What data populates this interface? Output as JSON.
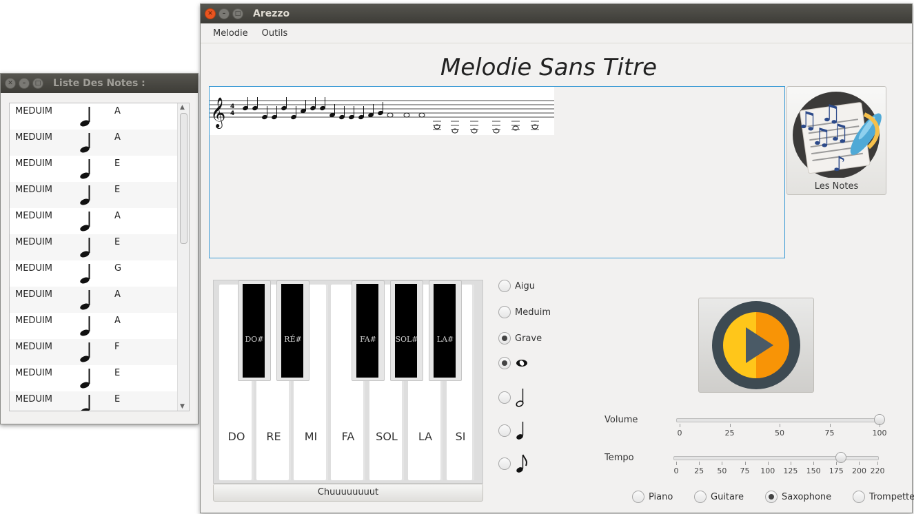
{
  "notes_window": {
    "title": "Liste Des Notes :",
    "rows": [
      {
        "level": "MEDUIM",
        "note": "A"
      },
      {
        "level": "MEDUIM",
        "note": "A"
      },
      {
        "level": "MEDUIM",
        "note": "E"
      },
      {
        "level": "MEDUIM",
        "note": "E"
      },
      {
        "level": "MEDUIM",
        "note": "A"
      },
      {
        "level": "MEDUIM",
        "note": "E"
      },
      {
        "level": "MEDUIM",
        "note": "G"
      },
      {
        "level": "MEDUIM",
        "note": "A"
      },
      {
        "level": "MEDUIM",
        "note": "A"
      },
      {
        "level": "MEDUIM",
        "note": "F"
      },
      {
        "level": "MEDUIM",
        "note": "E"
      },
      {
        "level": "MEDUIM",
        "note": "E"
      }
    ]
  },
  "main_window": {
    "title": "Arezzo",
    "menus": [
      "Melodie",
      "Outils"
    ],
    "melody_title": "Melodie Sans Titre",
    "notes_button_label": "Les Notes",
    "white_keys": [
      "DO",
      "RE",
      "MI",
      "FA",
      "SOL",
      "LA",
      "SI"
    ],
    "black_keys": [
      "DO#",
      "RÉ#",
      "FA#",
      "SOL#",
      "LA#"
    ],
    "silence_button": "Chuuuuuuuut",
    "pitch_options": [
      {
        "label": "Aigu",
        "selected": false
      },
      {
        "label": "Meduim",
        "selected": false
      },
      {
        "label": "Grave",
        "selected": true
      }
    ],
    "duration_options": [
      {
        "icon": "whole-note-icon",
        "glyph": "𝅝",
        "selected": true
      },
      {
        "icon": "half-note-icon",
        "glyph": "𝅗𝅥",
        "selected": false
      },
      {
        "icon": "quarter-note-icon",
        "glyph": "♩",
        "selected": false
      },
      {
        "icon": "eighth-note-icon",
        "glyph": "♪",
        "selected": false
      }
    ],
    "volume": {
      "label": "Volume",
      "value": 100,
      "min": 0,
      "max": 100,
      "ticks": [
        "0",
        "25",
        "50",
        "75",
        "100"
      ]
    },
    "tempo": {
      "label": "Tempo",
      "value": 180,
      "min": 0,
      "max": 220,
      "ticks": [
        "0",
        "25",
        "50",
        "75",
        "100",
        "125",
        "150",
        "175",
        "200",
        "220"
      ]
    },
    "instruments": [
      {
        "label": "Piano",
        "selected": false
      },
      {
        "label": "Guitare",
        "selected": false
      },
      {
        "label": "Saxophone",
        "selected": true
      },
      {
        "label": "Trompette",
        "selected": false
      }
    ],
    "colors": {
      "accent": "#3c9bd5",
      "close_button": "#e95420",
      "play_orange": "#f89406",
      "play_dark": "#3d4a52"
    }
  }
}
